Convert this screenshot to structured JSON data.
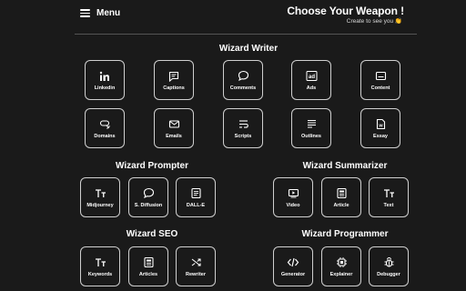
{
  "header": {
    "menu_label": "Menu",
    "title": "Choose Your Weapon !",
    "subtitle": "Create to see you 👏"
  },
  "sections": {
    "writer": {
      "title": "Wizard Writer",
      "items": [
        {
          "label": "Linkedin",
          "icon": "linkedin-icon"
        },
        {
          "label": "Captions",
          "icon": "caption-icon"
        },
        {
          "label": "Comments",
          "icon": "comment-bubble-icon"
        },
        {
          "label": "Ads",
          "icon": "ad-icon"
        },
        {
          "label": "Content",
          "icon": "content-icon"
        },
        {
          "label": "Domains",
          "icon": "domain-link-icon"
        },
        {
          "label": "Emails",
          "icon": "email-icon"
        },
        {
          "label": "Scripts",
          "icon": "script-icon"
        },
        {
          "label": "Outlines",
          "icon": "outline-icon"
        },
        {
          "label": "Essay",
          "icon": "essay-icon"
        }
      ]
    },
    "prompter": {
      "title": "Wizard Prompter",
      "items": [
        {
          "label": "Midjourney",
          "icon": "text-size-icon"
        },
        {
          "label": "S. Diffusion",
          "icon": "comment-bubble-icon"
        },
        {
          "label": "DALL-E",
          "icon": "document-icon"
        }
      ]
    },
    "summarizer": {
      "title": "Wizard Summarizer",
      "items": [
        {
          "label": "Video",
          "icon": "video-icon"
        },
        {
          "label": "Article",
          "icon": "article-icon"
        },
        {
          "label": "Text",
          "icon": "text-size-icon"
        }
      ]
    },
    "seo": {
      "title": "Wizard SEO",
      "items": [
        {
          "label": "Keywords",
          "icon": "text-size-icon"
        },
        {
          "label": "Articles",
          "icon": "article-icon"
        },
        {
          "label": "Rewriter",
          "icon": "shuffle-icon"
        }
      ]
    },
    "programmer": {
      "title": "Wizard Programmer",
      "items": [
        {
          "label": "Generator",
          "icon": "code-icon"
        },
        {
          "label": "Explainer",
          "icon": "chip-icon"
        },
        {
          "label": "Debugger",
          "icon": "bug-icon"
        }
      ]
    }
  },
  "colors": {
    "background": "#1a1a1a",
    "tile_border": "#cfcfcf",
    "text": "#ffffff"
  }
}
